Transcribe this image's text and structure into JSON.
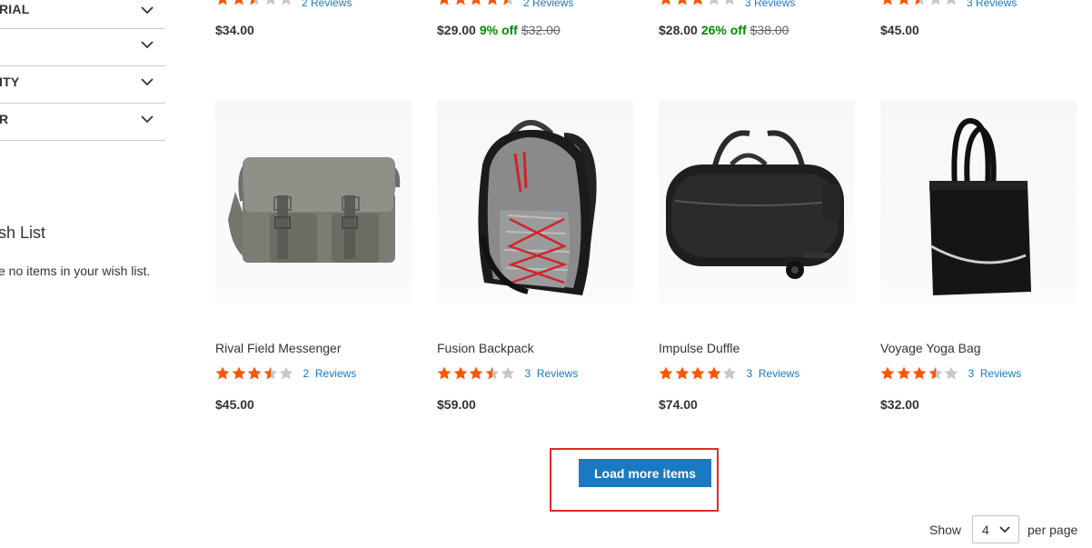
{
  "sidebar": {
    "filters": [
      {
        "label": "RIAL"
      },
      {
        "label": ""
      },
      {
        "label": "ITY"
      },
      {
        "label": "R"
      }
    ],
    "wishlist_title": "sh List",
    "wishlist_empty": "e no items in your wish list."
  },
  "top_row": [
    {
      "reviews": "2  Reviews",
      "price": "$34.00",
      "discount": "",
      "old_price": "",
      "rating": 2.5
    },
    {
      "reviews": "2  Reviews",
      "price": "$29.00",
      "discount": "9% off",
      "old_price": "$32.00",
      "rating": 4.5
    },
    {
      "reviews": "3  Reviews",
      "price": "$28.00",
      "discount": "26% off",
      "old_price": "$38.00",
      "rating": 3
    },
    {
      "reviews": "3  Reviews",
      "price": "$45.00",
      "discount": "",
      "old_price": "",
      "rating": 2.5
    }
  ],
  "products": [
    {
      "name": "Rival Field Messenger",
      "review_count": "2",
      "review_label": "Reviews",
      "price": "$45.00",
      "rating": 3.5,
      "image_icon": "messenger-bag-icon"
    },
    {
      "name": "Fusion Backpack",
      "review_count": "3",
      "review_label": "Reviews",
      "price": "$59.00",
      "rating": 3.5,
      "image_icon": "backpack-icon"
    },
    {
      "name": "Impulse Duffle",
      "review_count": "3",
      "review_label": "Reviews",
      "price": "$74.00",
      "rating": 4,
      "image_icon": "duffle-bag-icon"
    },
    {
      "name": "Voyage Yoga Bag",
      "review_count": "3",
      "review_label": "Reviews",
      "price": "$32.00",
      "rating": 3.5,
      "image_icon": "tote-bag-icon"
    }
  ],
  "load_more": {
    "label": "Load more items"
  },
  "toolbar": {
    "show_label": "Show",
    "limiter_value": "4",
    "per_page_label": "per page"
  },
  "colors": {
    "star": "#ff5501",
    "star_empty": "#c7c7c7",
    "link": "#1979c3",
    "discount": "#008a00",
    "button": "#1979c3",
    "highlight": "#e02b27"
  }
}
